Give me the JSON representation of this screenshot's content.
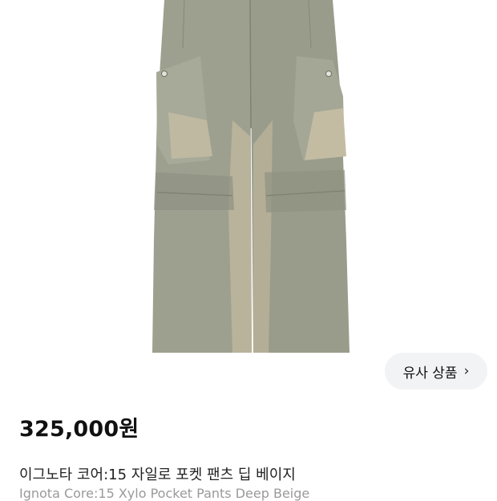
{
  "product": {
    "image_alt": "product-photo",
    "similar_button_label": "유사 상품",
    "price": "325,000원",
    "name_ko": "이그노타 코어:15 자일로 포켓 팬츠 딥 베이지",
    "name_en": "Ignota Core:15 Xylo Pocket Pants Deep Beige"
  },
  "icons": {
    "similar_chevron": "chevron-right-icon"
  },
  "colors": {
    "pants_main": "#9c9f8e",
    "pants_panel": "#b3ad98",
    "button_bg": "#f2f3f5"
  }
}
